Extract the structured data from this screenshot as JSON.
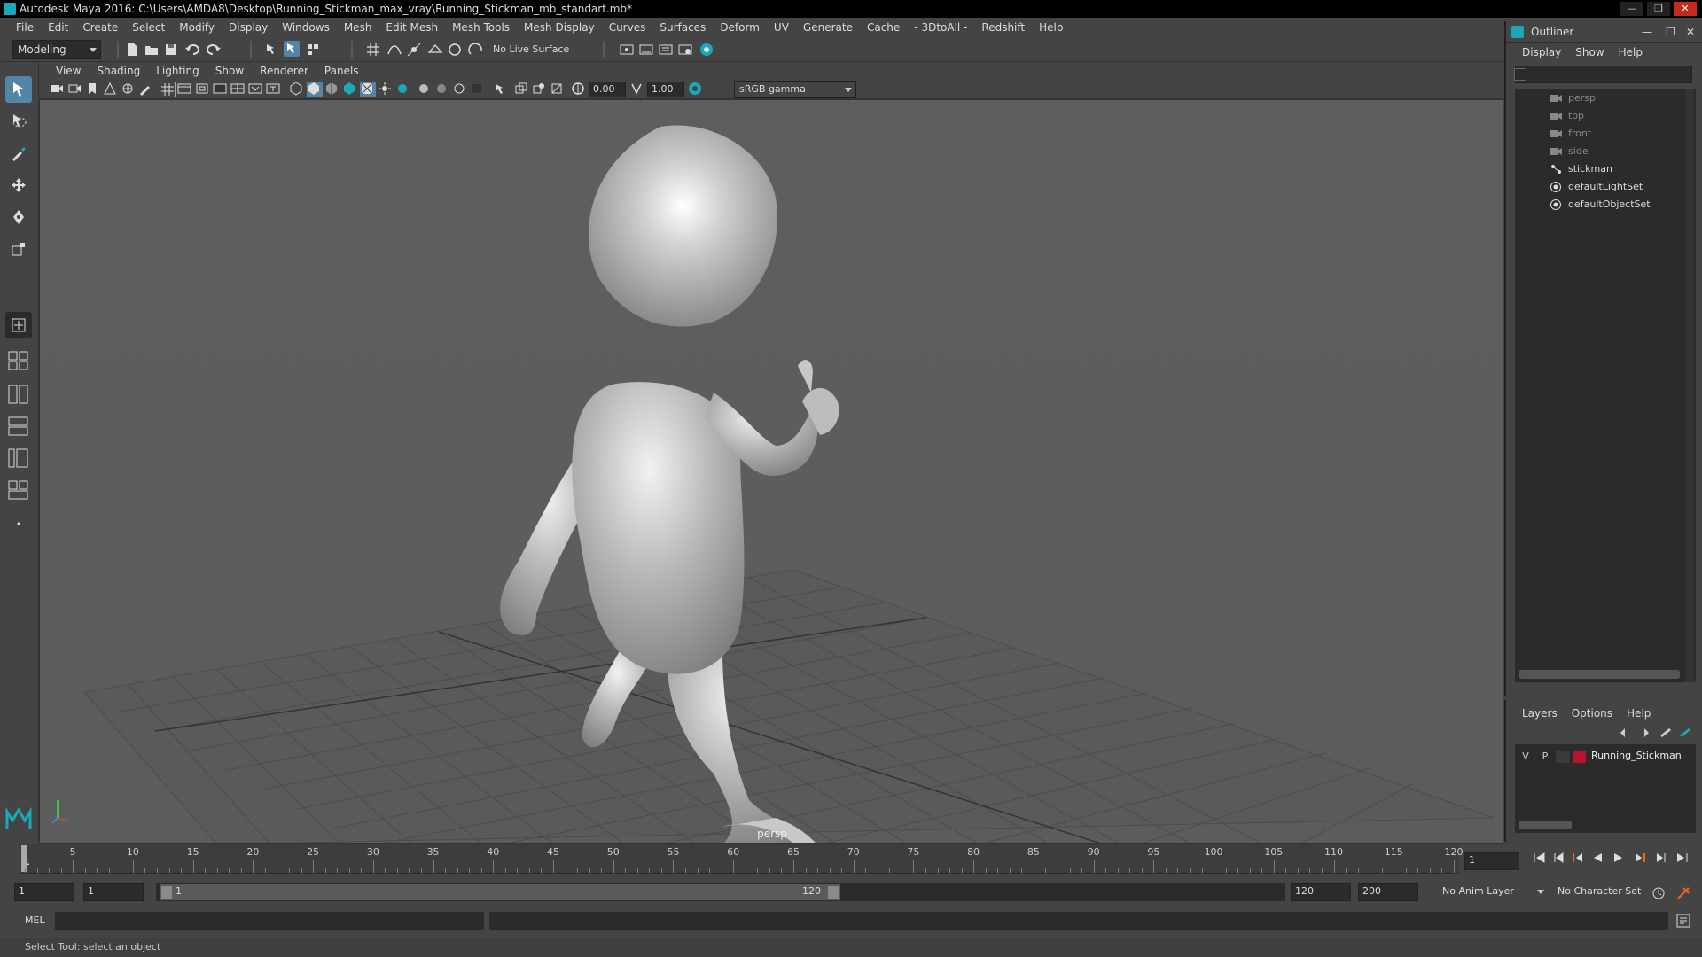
{
  "window": {
    "title": "Autodesk Maya 2016: C:\\Users\\AMDA8\\Desktop\\Running_Stickman_max_vray\\Running_Stickman_mb_standart.mb*",
    "controls": [
      "minimize",
      "restore",
      "close"
    ]
  },
  "menubar": [
    "File",
    "Edit",
    "Create",
    "Select",
    "Modify",
    "Display",
    "Windows",
    "Mesh",
    "Edit Mesh",
    "Mesh Tools",
    "Mesh Display",
    "Curves",
    "Surfaces",
    "Deform",
    "UV",
    "Generate",
    "Cache",
    "- 3DtoAll -",
    "Redshift",
    "Help"
  ],
  "statusline": {
    "mode": "Modeling",
    "live_surface": "No Live Surface"
  },
  "viewport": {
    "menu": [
      "View",
      "Shading",
      "Lighting",
      "Show",
      "Renderer",
      "Panels"
    ],
    "exposure": "0.00",
    "gamma": "1.00",
    "color_space": "sRGB gamma",
    "camera_label": "persp"
  },
  "outliner": {
    "title": "Outliner",
    "menu": [
      "Display",
      "Show",
      "Help"
    ],
    "items": [
      {
        "label": "persp",
        "icon": "camera-icon",
        "dim": true
      },
      {
        "label": "top",
        "icon": "camera-icon",
        "dim": true
      },
      {
        "label": "front",
        "icon": "camera-icon",
        "dim": true
      },
      {
        "label": "side",
        "icon": "camera-icon",
        "dim": true
      },
      {
        "label": "stickman",
        "icon": "joint-icon",
        "dim": false
      },
      {
        "label": "defaultLightSet",
        "icon": "set-icon",
        "dim": false
      },
      {
        "label": "defaultObjectSet",
        "icon": "set-icon",
        "dim": false
      }
    ]
  },
  "layers": {
    "menu": [
      "Layers",
      "Options",
      "Help"
    ],
    "rows": [
      {
        "visible": "V",
        "playback": "P",
        "color": "#b5132e",
        "name": "Running_Stickman"
      }
    ]
  },
  "timeline": {
    "ticks": [
      5,
      10,
      15,
      20,
      25,
      30,
      35,
      40,
      45,
      50,
      55,
      60,
      65,
      70,
      75,
      80,
      85,
      90,
      95,
      100,
      105,
      110,
      115,
      120
    ],
    "first_label": "1",
    "current_frame": "1",
    "range_start": 1,
    "range_end": 120
  },
  "range": {
    "start": "1",
    "playback_start": "1",
    "slider_start": "1",
    "slider_end": "120",
    "playback_end": "120",
    "end": "200",
    "anim_layer": "No Anim Layer",
    "character_set": "No Character Set"
  },
  "cmdline": {
    "label": "MEL"
  },
  "helpline": {
    "text": "Select Tool: select an object"
  },
  "colors": {
    "accent": "#5285a6",
    "maya_teal": "#1aa9b8",
    "layer_red": "#b5132e"
  }
}
